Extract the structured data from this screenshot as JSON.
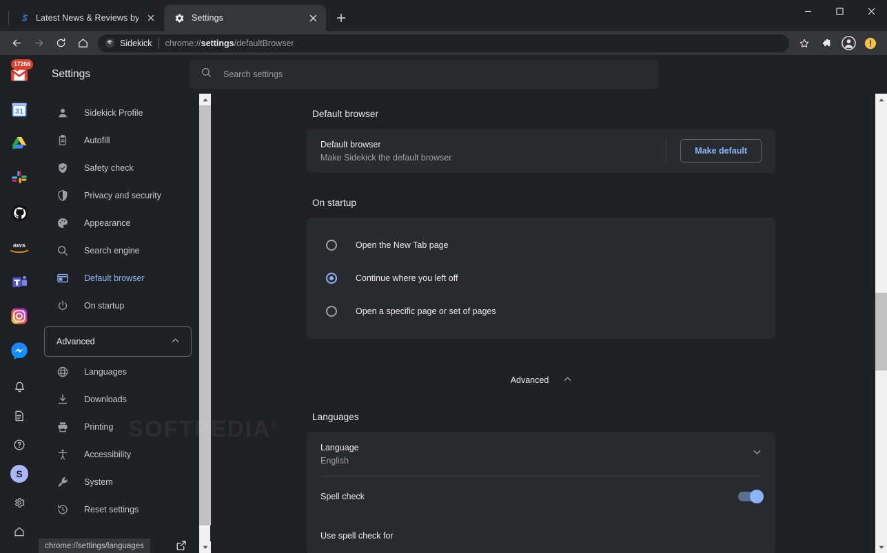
{
  "window": {
    "controls": {
      "minimize": "minimize-button",
      "maximize": "maximize-button",
      "close": "close-button"
    }
  },
  "tabs": [
    {
      "title": "Latest News & Reviews by Softpe",
      "favicon": "softpedia-logo-icon",
      "active": false
    },
    {
      "title": "Settings",
      "favicon": "gear-icon",
      "active": true
    }
  ],
  "newtab_label": "+",
  "omnibox": {
    "chip_label": "Sidekick",
    "url_prefix": "chrome://",
    "url_bold": "settings",
    "url_suffix": "/defaultBrowser"
  },
  "toolbar_right": {
    "bookmark": "star-icon",
    "extensions": "puzzle-icon",
    "profile": "account-icon",
    "update": "update-alert-icon"
  },
  "rail": {
    "apps": [
      {
        "name": "gmail",
        "badge": "17266"
      },
      {
        "name": "google-calendar",
        "badge": "31"
      },
      {
        "name": "google-drive",
        "badge": ""
      },
      {
        "name": "slack",
        "badge": ""
      },
      {
        "name": "github",
        "badge": ""
      },
      {
        "name": "aws",
        "badge": ""
      },
      {
        "name": "microsoft-teams",
        "badge": ""
      },
      {
        "name": "instagram",
        "badge": ""
      },
      {
        "name": "facebook-messenger",
        "badge": ""
      }
    ],
    "bottom": [
      {
        "name": "notifications-icon"
      },
      {
        "name": "notes-icon"
      },
      {
        "name": "help-icon"
      },
      {
        "name": "avatar",
        "label": "S"
      },
      {
        "name": "settings-gear-icon"
      },
      {
        "name": "home-icon"
      }
    ]
  },
  "settings": {
    "title": "Settings",
    "search_placeholder": "Search settings",
    "menu": [
      {
        "label": "Sidekick Profile",
        "icon": "person-icon",
        "active": false
      },
      {
        "label": "Autofill",
        "icon": "clipboard-icon",
        "active": false
      },
      {
        "label": "Safety check",
        "icon": "shield-check-icon",
        "active": false
      },
      {
        "label": "Privacy and security",
        "icon": "shield-icon",
        "active": false
      },
      {
        "label": "Appearance",
        "icon": "palette-icon",
        "active": false
      },
      {
        "label": "Search engine",
        "icon": "search-icon",
        "active": false
      },
      {
        "label": "Default browser",
        "icon": "browser-window-icon",
        "active": true
      },
      {
        "label": "On startup",
        "icon": "power-icon",
        "active": false
      }
    ],
    "advanced_group_label": "Advanced",
    "advanced_menu": [
      {
        "label": "Languages",
        "icon": "globe-icon"
      },
      {
        "label": "Downloads",
        "icon": "download-icon"
      },
      {
        "label": "Printing",
        "icon": "printer-icon"
      },
      {
        "label": "Accessibility",
        "icon": "accessibility-icon"
      },
      {
        "label": "System",
        "icon": "wrench-icon"
      },
      {
        "label": "Reset settings",
        "icon": "history-restore-icon"
      }
    ]
  },
  "main": {
    "default_browser": {
      "section_title": "Default browser",
      "row_title": "Default browser",
      "row_sub": "Make Sidekick the default browser",
      "button": "Make default"
    },
    "on_startup": {
      "section_title": "On startup",
      "options": [
        {
          "label": "Open the New Tab page",
          "selected": false
        },
        {
          "label": "Continue where you left off",
          "selected": true
        },
        {
          "label": "Open a specific page or set of pages",
          "selected": false
        }
      ]
    },
    "advanced_toggle": "Advanced",
    "languages": {
      "section_title": "Languages",
      "language_row_title": "Language",
      "language_row_value": "English",
      "spell_check_label": "Spell check",
      "spell_check_on": true,
      "use_spell_check_for_label": "Use spell check for"
    }
  },
  "statusbar": {
    "url": "chrome://settings/languages"
  },
  "watermark": {
    "text": "SOFTPEDIA",
    "mark": "®"
  },
  "colors": {
    "page_bg": "#202124",
    "card_bg": "#292a2d",
    "toolbar_bg": "#35363a",
    "accent_blue": "#8ab4f8",
    "text_primary": "#e8eaed",
    "text_secondary": "#9aa0a6",
    "badge_red": "#e03e2d",
    "update_yellow": "#f2c14e"
  }
}
